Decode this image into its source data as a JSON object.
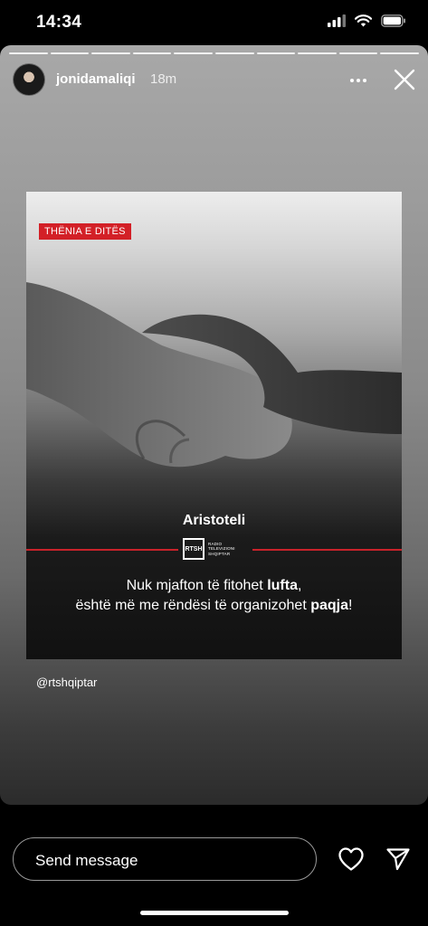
{
  "status_bar": {
    "time": "14:34"
  },
  "story": {
    "segments": 10,
    "username": "jonidamaliqi",
    "time_ago": "18m",
    "post": {
      "badge": "THËNIA E DITËS",
      "author": "Aristoteli",
      "logo": {
        "box": "RTSH",
        "line1": "RADIO",
        "line2": "TELEVIZIONI",
        "line3": "SHQIPTAR"
      },
      "quote_part1": "Nuk mjafton të fitohet ",
      "quote_bold1": "lufta",
      "quote_part2": ",",
      "quote_part3": "është më me rëndësi të organizohet ",
      "quote_bold2": "paqja",
      "quote_part4": "!"
    },
    "mention": "@rtshqiptar"
  },
  "composer": {
    "placeholder": "Send message"
  },
  "colors": {
    "accent_red": "#d32027"
  }
}
